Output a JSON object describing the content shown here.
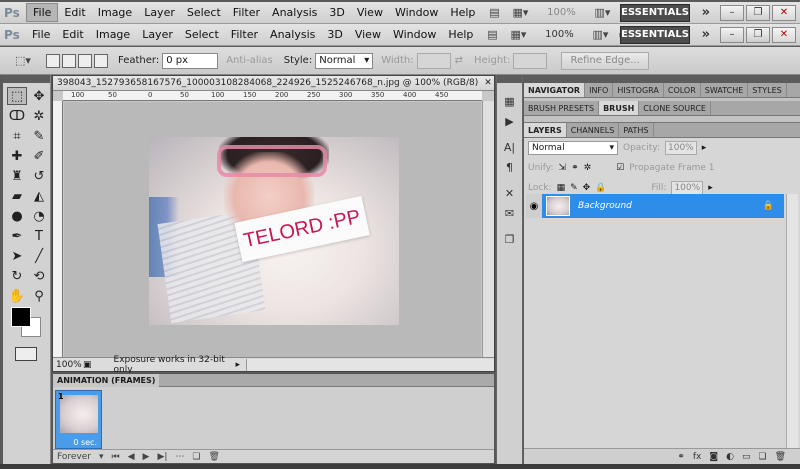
{
  "app": {
    "logo": "Ps",
    "workspace": "ESSENTIALS",
    "zoom": "100%"
  },
  "menu": [
    "File",
    "Edit",
    "Image",
    "Layer",
    "Select",
    "Filter",
    "Analysis",
    "3D",
    "View",
    "Window",
    "Help"
  ],
  "options": {
    "feather_label": "Feather:",
    "feather_value": "0 px",
    "antialias_label": "Anti-alias",
    "style_label": "Style:",
    "style_value": "Normal",
    "width_label": "Width:",
    "height_label": "Height:",
    "refine_edge": "Refine Edge..."
  },
  "document": {
    "tab_title": "398043_152793658167576_100003108284068_224926_1525246768_n.jpg @ 100% (RGB/8)",
    "ruler_marks": [
      "100",
      "50",
      "0",
      "50",
      "100",
      "150",
      "200",
      "250",
      "300",
      "350",
      "400",
      "450"
    ],
    "sign_text": "TELORD :PP",
    "zoom": "100%",
    "status": "Exposure works in 32-bit only"
  },
  "animation": {
    "tab": "ANIMATION (FRAMES)",
    "frame_number": "1",
    "frame_delay": "0 sec.",
    "loop": "Forever"
  },
  "panels": {
    "row1": [
      "NAVIGATOR",
      "INFO",
      "HISTOGRA",
      "COLOR",
      "SWATCHE",
      "STYLES"
    ],
    "row2": [
      "BRUSH PRESETS",
      "BRUSH",
      "CLONE SOURCE"
    ],
    "layers_tabs": [
      "LAYERS",
      "CHANNELS",
      "PATHS"
    ],
    "blend_mode": "Normal",
    "opacity_label": "Opacity:",
    "opacity_value": "100%",
    "unify_label": "Unify:",
    "propagate_label": "Propagate Frame 1",
    "lock_label": "Lock:",
    "fill_label": "Fill:",
    "fill_value": "100%",
    "layer_name": "Background"
  }
}
